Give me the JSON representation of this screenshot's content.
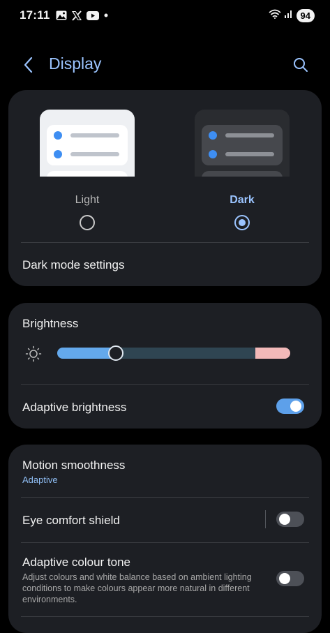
{
  "status_bar": {
    "time": "17:11",
    "battery": "94",
    "left_icons": [
      "gallery-icon",
      "x-icon",
      "youtube-icon",
      "dot-icon"
    ],
    "right_icons": [
      "wifi-icon",
      "signal-icon"
    ]
  },
  "header": {
    "title": "Display",
    "back_icon": "chevron-left-icon",
    "search_icon": "search-icon"
  },
  "theme": {
    "light_label": "Light",
    "dark_label": "Dark",
    "selected": "dark",
    "dark_mode_settings": "Dark mode settings"
  },
  "brightness": {
    "title": "Brightness",
    "level": 0.25,
    "adaptive_label": "Adaptive brightness",
    "adaptive_on": true
  },
  "motion": {
    "title": "Motion smoothness",
    "value": "Adaptive",
    "eye_comfort_label": "Eye comfort shield",
    "eye_comfort_on": false,
    "adaptive_tone_label": "Adaptive colour tone",
    "adaptive_tone_desc": "Adjust colours and white balance based on ambient lighting conditions to make colours appear more natural in different environments.",
    "adaptive_tone_on": false
  },
  "colors": {
    "accent": "#9bc4ff",
    "toggle_on": "#5da0ea",
    "card": "#1d1f24",
    "background": "#000000"
  }
}
